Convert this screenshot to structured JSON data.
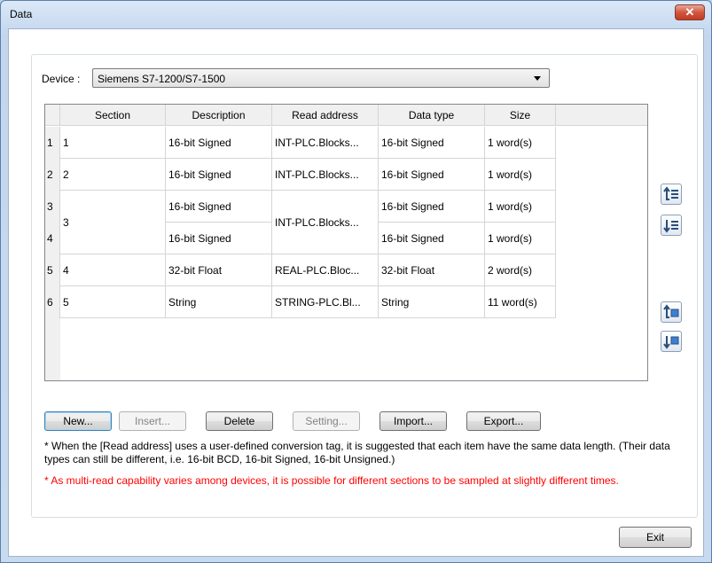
{
  "window": {
    "title": "Data",
    "close_glyph": "✕"
  },
  "device": {
    "label": "Device :",
    "value": "Siemens S7-1200/S7-1500"
  },
  "grid": {
    "columns": [
      "Section",
      "Description",
      "Read address",
      "Data type",
      "Size"
    ],
    "row_numbers": [
      "1",
      "2",
      "3",
      "4",
      "5",
      "6"
    ],
    "rows": [
      {
        "section": "1",
        "description": "16-bit Signed",
        "read_address": "INT-PLC.Blocks...",
        "data_type": "16-bit Signed",
        "size": "1 word(s)"
      },
      {
        "section": "2",
        "description": "16-bit Signed",
        "read_address": "INT-PLC.Blocks...",
        "data_type": "16-bit Signed",
        "size": "1 word(s)"
      },
      {
        "section": "3",
        "description": "16-bit Signed",
        "read_address": "INT-PLC.Blocks...",
        "data_type": "16-bit Signed",
        "size": "1 word(s)"
      },
      {
        "section": "",
        "description": "16-bit Signed",
        "read_address": "",
        "data_type": "16-bit Signed",
        "size": "1 word(s)"
      },
      {
        "section": "4",
        "description": "32-bit Float",
        "read_address": "REAL-PLC.Bloc...",
        "data_type": "32-bit Float",
        "size": "2 word(s)"
      },
      {
        "section": "5",
        "description": "String",
        "read_address": "STRING-PLC.Bl...",
        "data_type": "String",
        "size": "11 word(s)"
      }
    ]
  },
  "buttons": {
    "new": "New...",
    "insert": "Insert...",
    "delete": "Delete",
    "setting": "Setting...",
    "import": "Import...",
    "export": "Export...",
    "exit": "Exit"
  },
  "side_icons": [
    "move-row-up-icon",
    "move-row-down-icon",
    "move-section-up-icon",
    "move-section-down-icon"
  ],
  "notes": {
    "conversion_tag": "* When the [Read address] uses a user-defined conversion tag, it is suggested that each item have the same data length. (Their data types can still be different, i.e. 16-bit BCD, 16-bit Signed, 16-bit Unsigned.)",
    "multi_read": "* As multi-read capability varies among devices, it is possible for different sections to be sampled at slightly different times."
  },
  "colors": {
    "warning_text": "#ff0000",
    "close_button": "#c13a21",
    "title_bar": "#c3d6ee"
  }
}
